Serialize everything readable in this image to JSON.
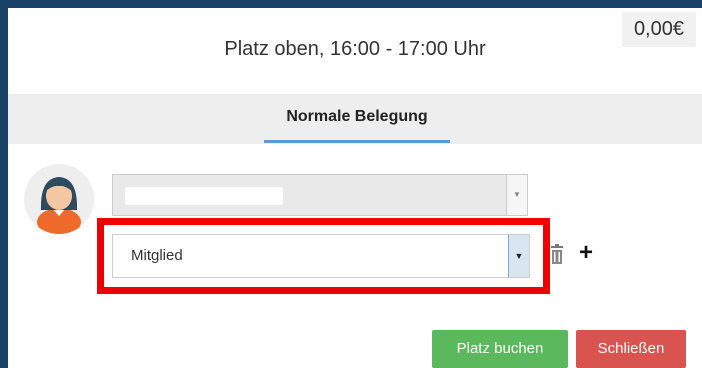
{
  "modal": {
    "title": "Platz oben, 16:00 - 17:00 Uhr",
    "price": "0,00€"
  },
  "tabs": [
    {
      "label": "Normale Belegung",
      "active": true
    }
  ],
  "booking": {
    "player_select_value": "",
    "role_select": {
      "selected": "Mitglied"
    },
    "icons": [
      "user-avatar-icon",
      "chevron-down-icon",
      "trash-icon",
      "plus-icon"
    ]
  },
  "buttons": {
    "book_label": "Platz buchen",
    "close_label": "Schließen"
  },
  "colors": {
    "background": "#1a4266",
    "tab_underline": "#5b9bd5",
    "book_button": "#5cb85c",
    "close_button": "#d9534f",
    "highlight": "#ee0000"
  }
}
